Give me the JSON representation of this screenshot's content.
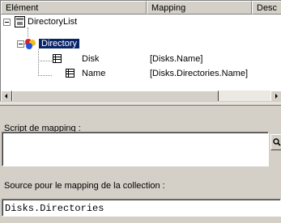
{
  "tree": {
    "columns": [
      "Elément",
      "Mapping",
      "Desc"
    ],
    "rows": [
      {
        "name": "DirectoryList",
        "mapping": "",
        "icon": "document-icon"
      },
      {
        "name": "Directory",
        "mapping": "",
        "icon": "collection-icon",
        "selected": true
      },
      {
        "name": "Disk",
        "mapping": "[Disks.Name]",
        "icon": "field-icon"
      },
      {
        "name": "Name",
        "mapping": "[Disks.Directories.Name]",
        "icon": "field-icon"
      }
    ]
  },
  "script_section": {
    "label": "Script de mapping :",
    "value": ""
  },
  "source_section": {
    "label": "Source pour le mapping de la collection :",
    "value": "Disks.Directories"
  }
}
